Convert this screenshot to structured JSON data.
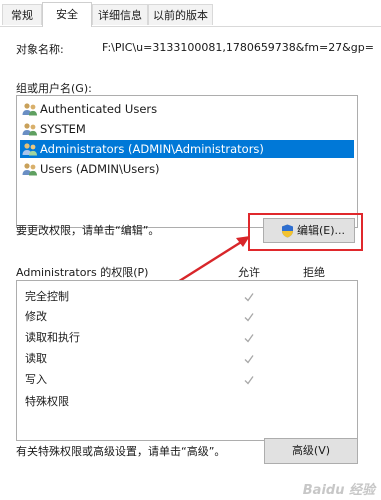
{
  "tabs": [
    {
      "label": "常规"
    },
    {
      "label": "安全"
    },
    {
      "label": "详细信息"
    },
    {
      "label": "以前的版本"
    }
  ],
  "object_name": {
    "label": "对象名称:",
    "value": "F:\\PIC\\u=3133100081,1780659738&fm=27&gp="
  },
  "groups": {
    "label": "组或用户名(G):",
    "users": [
      {
        "name": "Authenticated Users",
        "selected": false
      },
      {
        "name": "SYSTEM",
        "selected": false
      },
      {
        "name": "Administrators (ADMIN\\Administrators)",
        "selected": true
      },
      {
        "name": "Users (ADMIN\\Users)",
        "selected": false
      }
    ]
  },
  "change_hint": "要更改权限，请单击“编辑”。",
  "edit_button": {
    "label": "编辑(E)...",
    "icon": "uac-shield-icon"
  },
  "permissions": {
    "title": "Administrators 的权限(P)",
    "allow_label": "允许",
    "deny_label": "拒绝",
    "rows": [
      {
        "name": "完全控制",
        "allow": true,
        "deny": false
      },
      {
        "name": "修改",
        "allow": true,
        "deny": false
      },
      {
        "name": "读取和执行",
        "allow": true,
        "deny": false
      },
      {
        "name": "读取",
        "allow": true,
        "deny": false
      },
      {
        "name": "写入",
        "allow": true,
        "deny": false
      },
      {
        "name": "特殊权限",
        "allow": false,
        "deny": false
      }
    ]
  },
  "advanced_hint": "有关特殊权限或高级设置，请单击“高级”。",
  "advanced_button": {
    "label": "高级(V)"
  },
  "colors": {
    "selection": "#0078d7",
    "highlight_box": "#e0282c",
    "arrow": "#d8262a",
    "check_gray": "#a8a8a8"
  },
  "watermark": "Baidu 经验"
}
